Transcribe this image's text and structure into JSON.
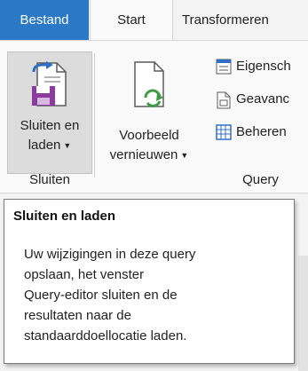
{
  "tabs": {
    "file": "Bestand",
    "start": "Start",
    "transform": "Transformeren"
  },
  "ribbon": {
    "close_load": {
      "line1": "Sluiten en",
      "line2": "laden",
      "icon": "save-close-icon"
    },
    "refresh_preview": {
      "line1": "Voorbeeld",
      "line2": "vernieuwen",
      "icon": "refresh-document-icon"
    },
    "properties": {
      "label": "Eigensch",
      "icon": "properties-icon"
    },
    "advanced_editor": {
      "label": "Geavanc",
      "icon": "advanced-editor-icon"
    },
    "manage": {
      "label": "Beheren",
      "icon": "table-grid-icon"
    },
    "groups": {
      "close": "Sluiten",
      "query": "Query"
    }
  },
  "tooltip": {
    "title": "Sluiten en laden",
    "lines": [
      "Uw wijzigingen in deze query",
      "opslaan, het venster",
      "Query-editor sluiten en de",
      "resultaten naar de",
      "standaarddoellocatie laden."
    ]
  },
  "colors": {
    "file_tab": "#2b78c6",
    "accent_purple": "#8a3c9c",
    "accent_blue": "#2f6fc4",
    "accent_green": "#3f9b47"
  }
}
